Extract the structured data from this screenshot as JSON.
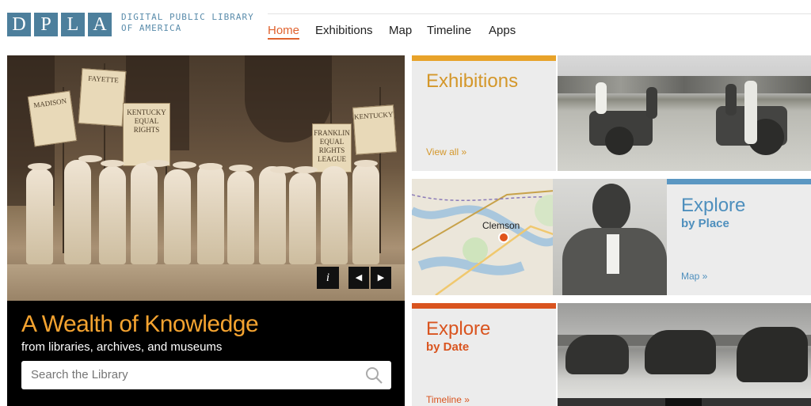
{
  "header": {
    "logo_letters": [
      "D",
      "P",
      "L",
      "A"
    ],
    "logo_line1": "DIGITAL PUBLIC LIBRARY",
    "logo_line2": "OF AMERICA",
    "nav": [
      "Home",
      "Exhibitions",
      "Map",
      "Timeline",
      "Apps"
    ],
    "active_nav": "Home"
  },
  "hero": {
    "title": "A Wealth of Knowledge",
    "subtitle": "from libraries, archives, and museums",
    "search_placeholder": "Search the Library",
    "info_label": "i",
    "prev_label": "◀",
    "next_label": "▶",
    "banners": [
      "MADISON",
      "FAYETTE",
      "KENTUCKY EQUAL RIGHTS",
      "FRANKLIN EQUAL RIGHTS LEAGUE",
      "KENTUCKY"
    ]
  },
  "tiles": {
    "exhibitions": {
      "title": "Exhibitions",
      "link": "View all »",
      "accent": "#e8a32a"
    },
    "place": {
      "title": "Explore",
      "subtitle": "by Place",
      "link": "Map »",
      "map_label": "Clemson",
      "accent": "#5b97c2"
    },
    "date": {
      "title": "Explore",
      "subtitle": "by Date",
      "link": "Timeline »",
      "accent": "#d9541f"
    }
  },
  "colors": {
    "logo_blue": "#4d7f9c",
    "hero_title": "#f4a330",
    "active_nav": "#e0622e"
  }
}
